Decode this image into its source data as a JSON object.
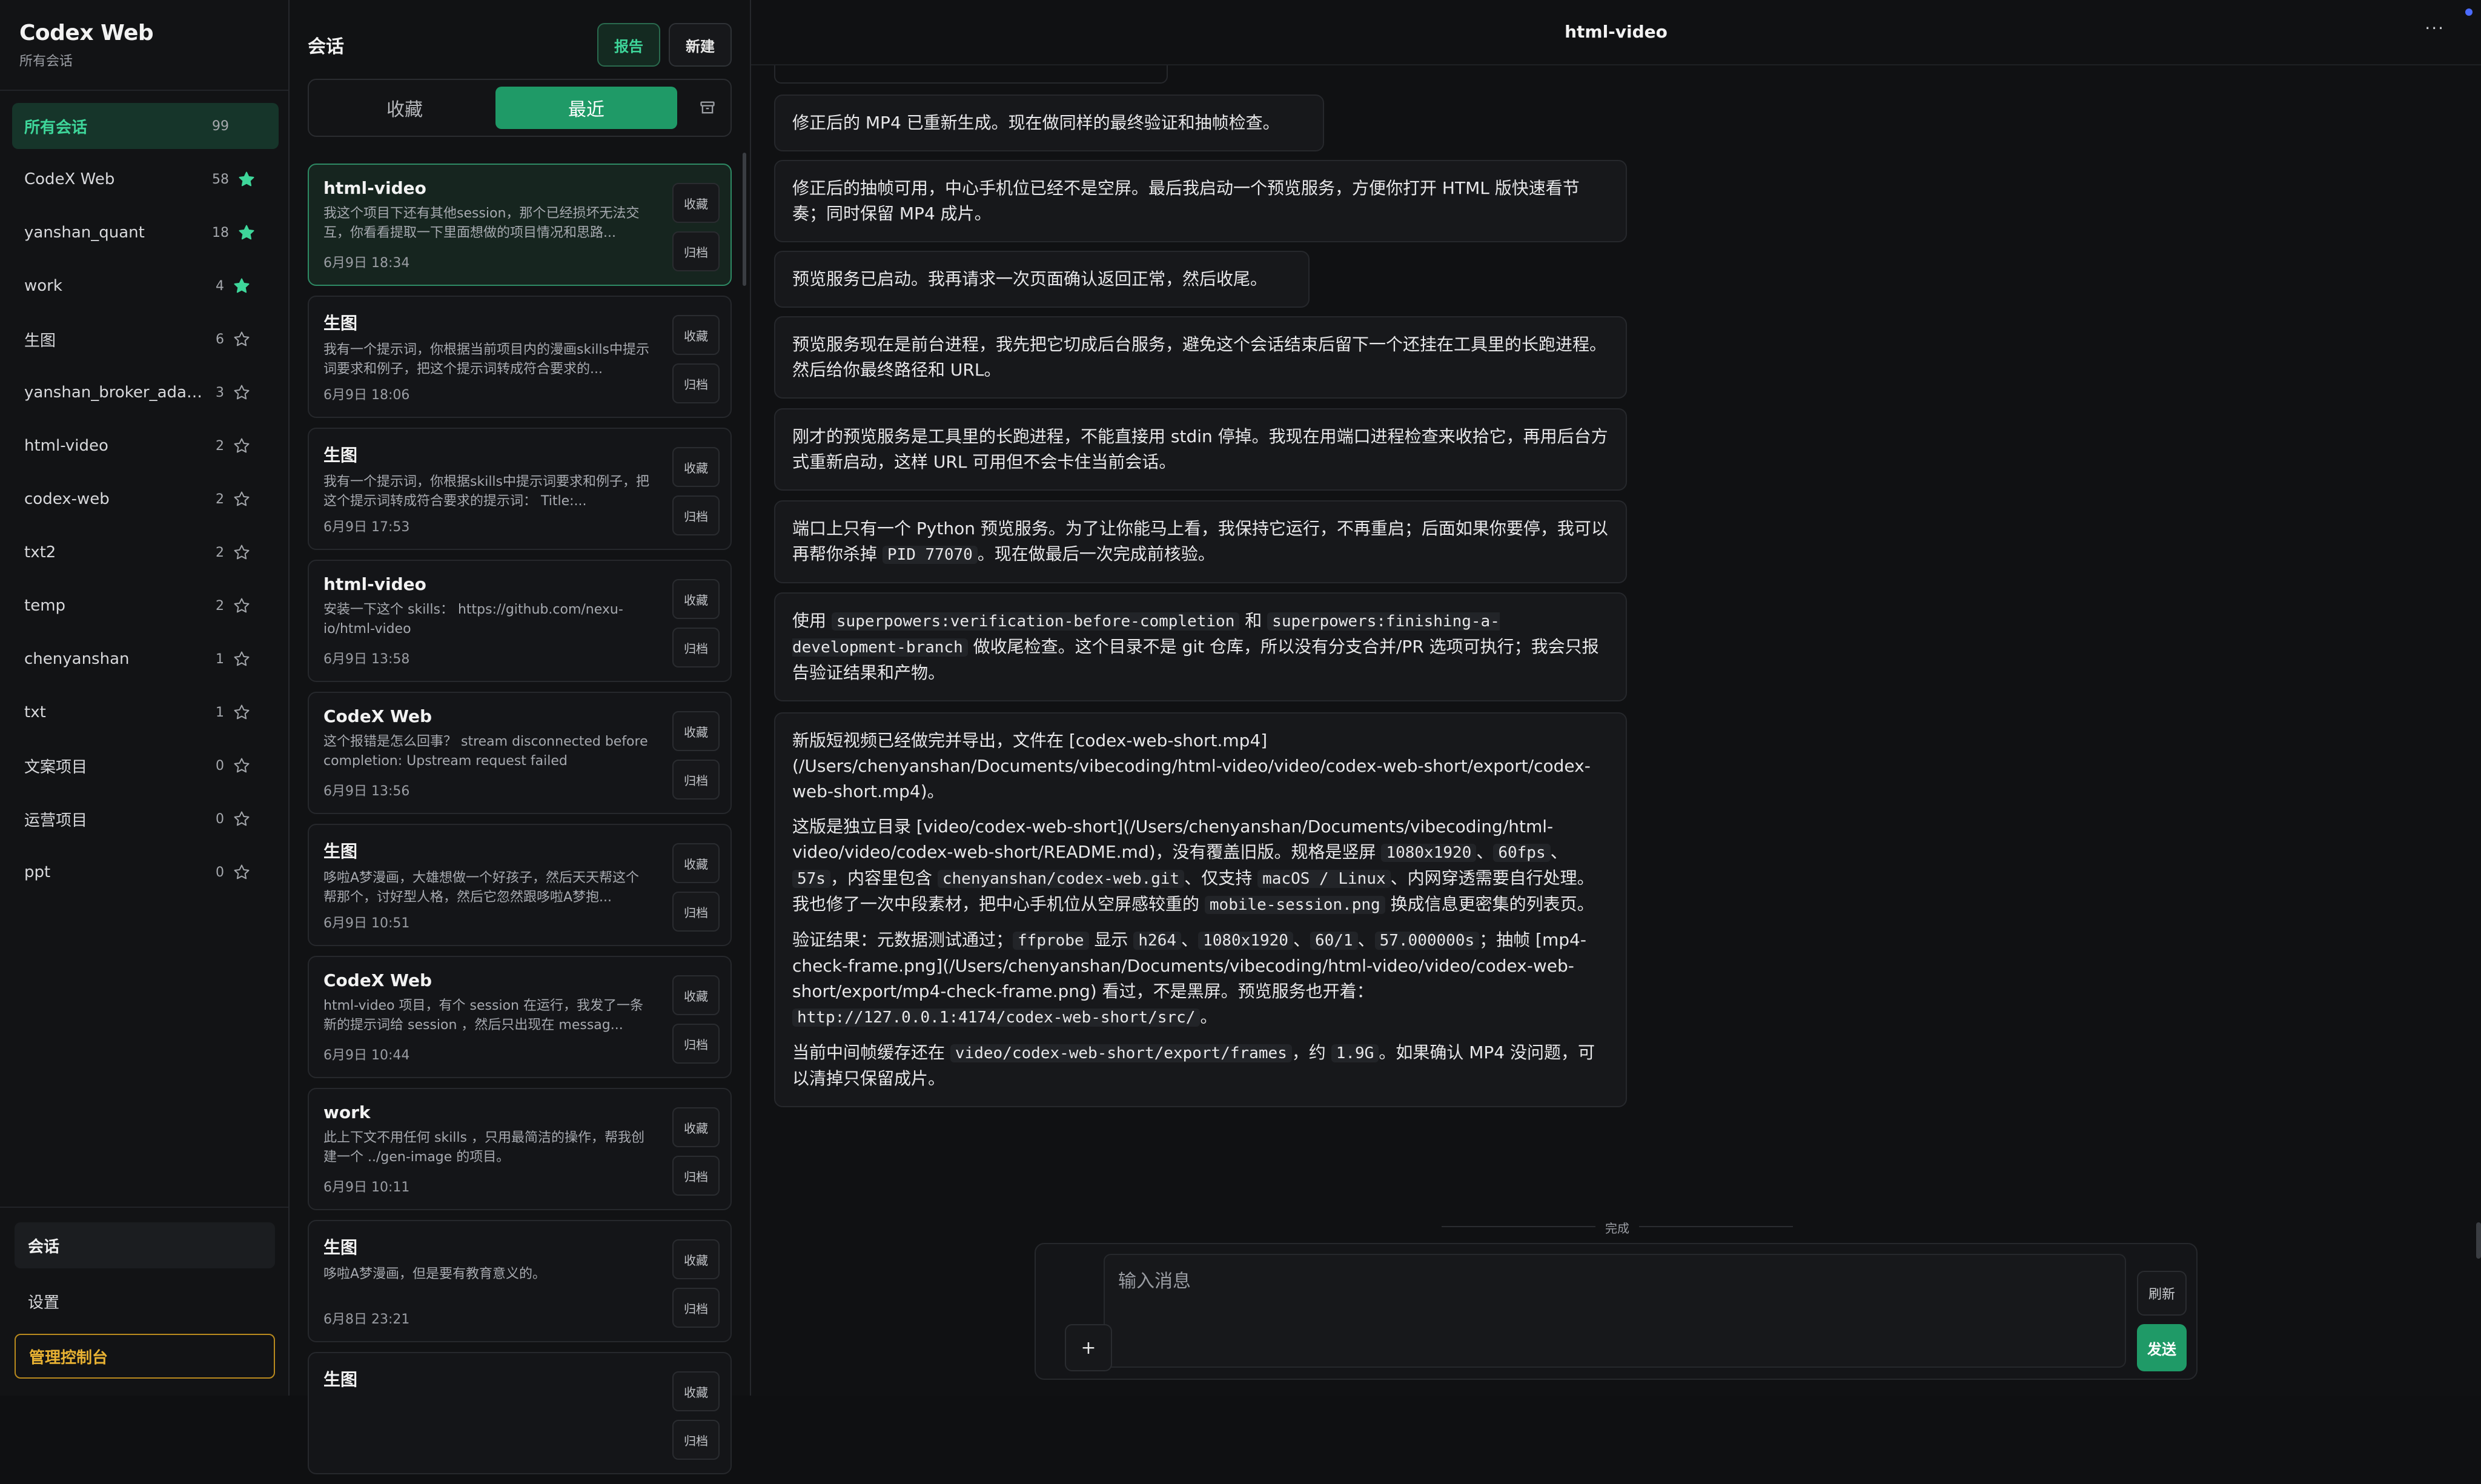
{
  "brand": {
    "title": "Codex Web",
    "subtitle": "所有会话"
  },
  "colors": {
    "accent": "#1f9a67",
    "accent_text": "#3ed69a",
    "admin": "#e8b233",
    "star": "#3ed69a"
  },
  "categories": [
    {
      "label": "所有会话",
      "count": "99",
      "starred": null
    },
    {
      "label": "CodeX Web",
      "count": "58",
      "starred": true
    },
    {
      "label": "yanshan_quant",
      "count": "18",
      "starred": true
    },
    {
      "label": "work",
      "count": "4",
      "starred": true
    },
    {
      "label": "生图",
      "count": "6",
      "starred": false
    },
    {
      "label": "yanshan_broker_adapt...",
      "count": "3",
      "starred": false
    },
    {
      "label": "html-video",
      "count": "2",
      "starred": false
    },
    {
      "label": "codex-web",
      "count": "2",
      "starred": false
    },
    {
      "label": "txt2",
      "count": "2",
      "starred": false
    },
    {
      "label": "temp",
      "count": "2",
      "starred": false
    },
    {
      "label": "chenyanshan",
      "count": "1",
      "starred": false
    },
    {
      "label": "txt",
      "count": "1",
      "starred": false
    },
    {
      "label": "文案项目",
      "count": "0",
      "starred": false
    },
    {
      "label": "运营项目",
      "count": "0",
      "starred": false
    },
    {
      "label": "ppt",
      "count": "0",
      "starred": false
    }
  ],
  "bottom_nav": {
    "sessions": "会话",
    "settings": "设置",
    "admin": "管理控制台"
  },
  "sessions_panel": {
    "title": "会话",
    "report_label": "报告",
    "new_label": "新建",
    "tab_favorites": "收藏",
    "tab_recent": "最近",
    "fav_label": "收藏",
    "archive_label": "归档",
    "items": [
      {
        "title": "html-video",
        "snippet": "我这个项目下还有其他session，那个已经损坏无法交互，你看看提取一下里面想做的项目情况和思路...",
        "time": "6月9日 18:34"
      },
      {
        "title": "生图",
        "snippet": "我有一个提示词，你根据当前项目内的漫画skills中提示词要求和例子，把这个提示词转成符合要求的...",
        "time": "6月9日 18:06"
      },
      {
        "title": "生图",
        "snippet": "我有一个提示词，你根据skills中提示词要求和例子，把这个提示词转成符合要求的提示词： Title:...",
        "time": "6月9日 17:53"
      },
      {
        "title": "html-video",
        "snippet": "安装一下这个 skills： https://github.com/nexu-io/html-video",
        "time": "6月9日 13:58"
      },
      {
        "title": "CodeX Web",
        "snippet": "这个报错是怎么回事？ stream disconnected before completion: Upstream request failed",
        "time": "6月9日 13:56"
      },
      {
        "title": "生图",
        "snippet": "哆啦A梦漫画，大雄想做一个好孩子，然后天天帮这个帮那个，讨好型人格，然后它忽然跟哆啦A梦抱...",
        "time": "6月9日 10:51"
      },
      {
        "title": "CodeX Web",
        "snippet": "html-video 项目，有个 session 在运行，我发了一条新的提示词给 session ，然后只出现在 messag...",
        "time": "6月9日 10:44"
      },
      {
        "title": "work",
        "snippet": "此上下文不用任何 skills ，只用最简洁的操作，帮我创建一个 ../gen-image 的项目。",
        "time": "6月9日 10:11"
      },
      {
        "title": "生图",
        "snippet": "哆啦A梦漫画，但是要有教育意义的。",
        "time": "6月8日 23:21"
      },
      {
        "title": "生图",
        "snippet": "",
        "time": ""
      }
    ]
  },
  "chat": {
    "title": "html-video",
    "more": "···",
    "m1": "修正后的 MP4 已重新生成。现在做同样的最终验证和抽帧检查。",
    "m2": "修正后的抽帧可用，中心手机位已经不是空屏。最后我启动一个预览服务，方便你打开 HTML 版快速看节奏；同时保留 MP4 成片。",
    "m3": "预览服务已启动。我再请求一次页面确认返回正常，然后收尾。",
    "m4": "预览服务现在是前台进程，我先把它切成后台服务，避免这个会话结束后留下一个还挂在工具里的长跑进程。然后给你最终路径和 URL。",
    "m5": "刚才的预览服务是工具里的长跑进程，不能直接用 stdin 停掉。我现在用端口进程检查来收拾它，再用后台方式重新启动，这样 URL 可用但不会卡住当前会话。",
    "m6_a": "端口上只有一个 Python 预览服务。为了让你能马上看，我保持它运行，不再重启；后面如果你要停，我可以再帮你杀掉 ",
    "m6_code": "PID 77070",
    "m6_b": "。现在做最后一次完成前核验。",
    "m7_a": "使用 ",
    "m7_c1": "superpowers:verification-before-completion",
    "m7_b": " 和 ",
    "m7_c2": "superpowers:finishing-a-development-branch",
    "m7_c": " 做收尾检查。这个目录不是 git 仓库，所以没有分支合并/PR 选项可执行；我会只报告验证结果和产物。",
    "m8_p1": "新版短视频已经做完并导出，文件在 [codex-web-short.mp4](/Users/chenyanshan/Documents/vibecoding/html-video/video/codex-web-short/export/codex-web-short.mp4)。",
    "m8_p2_a": "这版是独立目录 [video/codex-web-short](/Users/chenyanshan/Documents/vibecoding/html-video/video/codex-web-short/README.md)，没有覆盖旧版。规格是竖屏 ",
    "m8_p2_c1": "1080x1920",
    "m8_p2_s1": "、",
    "m8_p2_c2": "60fps",
    "m8_p2_s2": "、",
    "m8_p2_c3": "57s",
    "m8_p2_b": "，内容里包含 ",
    "m8_p2_c4": "chenyanshan/codex-web.git",
    "m8_p2_c": "、仅支持 ",
    "m8_p2_c5": "macOS / Linux",
    "m8_p2_d": "、内网穿透需要自行处理。我也修了一次中段素材，把中心手机位从空屏感较重的 ",
    "m8_p2_c6": "mobile-session.png",
    "m8_p2_e": " 换成信息更密集的列表页。",
    "m8_p3_a": "验证结果：元数据测试通过；",
    "m8_p3_c1": "ffprobe",
    "m8_p3_b": " 显示 ",
    "m8_p3_c2": "h264",
    "m8_p3_s1": "、",
    "m8_p3_c3": "1080x1920",
    "m8_p3_s2": "、",
    "m8_p3_c4": "60/1",
    "m8_p3_s3": "、",
    "m8_p3_c5": "57.000000s",
    "m8_p3_c": "；抽帧 [mp4-check-frame.png](/Users/chenyanshan/Documents/vibecoding/html-video/video/codex-web-short/export/mp4-check-frame.png) 看过，不是黑屏。预览服务也开着：",
    "m8_p3_c6": "http://127.0.0.1:4174/codex-web-short/src/",
    "m8_p3_d": "。",
    "m8_p4_a": "当前中间帧缓存还在 ",
    "m8_p4_c1": "video/codex-web-short/export/frames",
    "m8_p4_b": "，约 ",
    "m8_p4_c2": "1.9G",
    "m8_p4_c": "。如果确认 MP4 没问题，可以清掉只保留成片。",
    "done_label": "完成"
  },
  "composer": {
    "placeholder": "输入消息",
    "plus": "+",
    "refresh": "刷新",
    "send": "发送"
  }
}
